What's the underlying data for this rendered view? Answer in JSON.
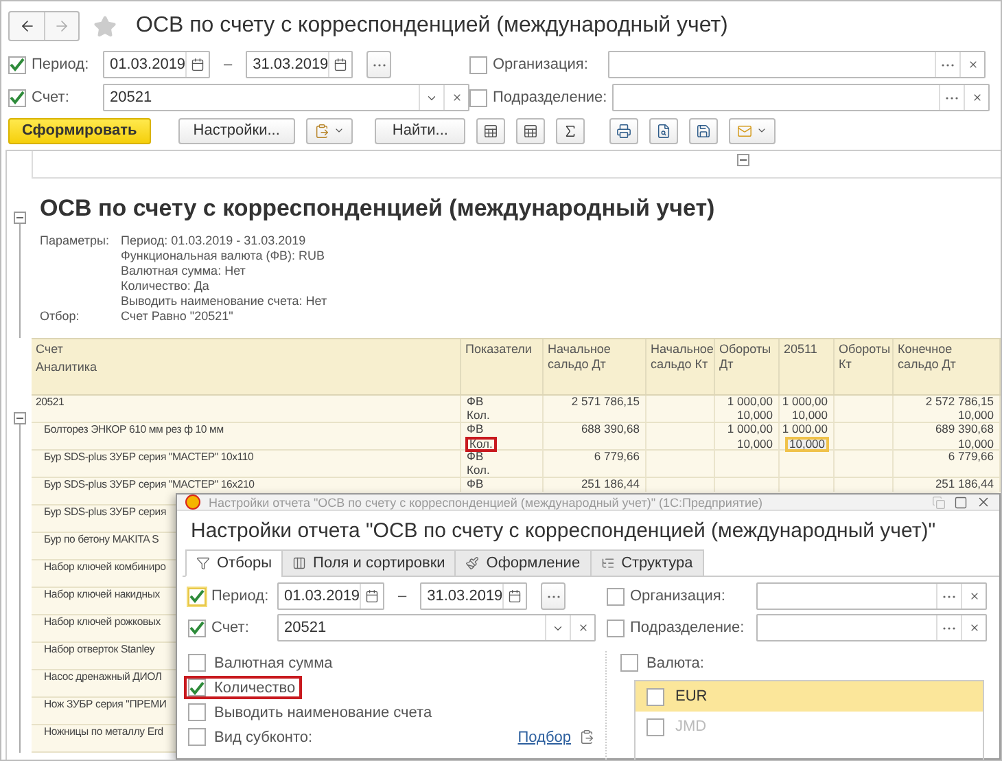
{
  "window": {
    "title": "ОСВ по счету с корреспонденцией (международный учет)"
  },
  "filters": {
    "period": {
      "checked": true,
      "label": "Период:",
      "from": "01.03.2019",
      "dash": "–",
      "to": "31.03.2019"
    },
    "account": {
      "checked": true,
      "label": "Счет:",
      "value": "20521"
    },
    "organization": {
      "checked": false,
      "label": "Организация:"
    },
    "division": {
      "checked": false,
      "label": "Подразделение:"
    }
  },
  "toolbar": {
    "generate": "Сформировать",
    "settings": "Настройки...",
    "find": "Найти..."
  },
  "report": {
    "title": "ОСВ по счету с корреспонденцией (международный учет)",
    "parameters": [
      {
        "label": "Параметры:",
        "values": [
          "Период: 01.03.2019 - 31.03.2019",
          "Функциональная валюта (ФВ): RUB",
          "Валютная сумма: Нет",
          "Количество: Да",
          "Выводить наименование счета: Нет"
        ]
      },
      {
        "label": "Отбор:",
        "values": [
          "Счет Равно \"20521\""
        ]
      }
    ],
    "table": {
      "account_header": [
        "Счет",
        "Аналитика"
      ],
      "columns": {
        "indicator": "Показатели",
        "opening_dt": "Начальное сальдо Дт",
        "opening_kt": "Начальное сальдо Кт",
        "turnover_dt": "Обороты Дт",
        "turnover_dt_sub": "20511",
        "turnover_kt": "Обороты Кт",
        "closing_dt": "Конечное сальдо Дт"
      },
      "rows": [
        {
          "name": "20521",
          "expanded": true,
          "lines": [
            {
              "indicator": "ФВ",
              "marked": false,
              "opening_dt": {
                "text": "2 571 786,15",
                "selected": false
              },
              "turnover_dt": {
                "text": "1 000,00",
                "selected": false
              },
              "turnover_dt_sub": {
                "text": "1 000,00",
                "selected": false
              },
              "closing_dt": {
                "text": "2 572 786,15",
                "selected": false
              }
            },
            {
              "indicator": "Кол.",
              "marked": false,
              "turnover_dt": {
                "text": "10,000",
                "selected": false
              },
              "turnover_dt_sub": {
                "text": "10,000",
                "selected": false
              },
              "closing_dt": {
                "text": "10,000",
                "selected": false
              }
            }
          ],
          "children": [
            {
              "name": "Болторез ЭНКОР 610 мм рез ф 10 мм",
              "lines": [
                {
                  "indicator": "ФВ",
                  "marked": false,
                  "opening_dt": {
                    "text": "688 390,68",
                    "selected": false
                  },
                  "turnover_dt": {
                    "text": "1 000,00",
                    "selected": false
                  },
                  "turnover_dt_sub": {
                    "text": "1 000,00",
                    "selected": false
                  },
                  "closing_dt": {
                    "text": "689 390,68",
                    "selected": false
                  }
                },
                {
                  "indicator": "Кол.",
                  "marked": true,
                  "turnover_dt": {
                    "text": "10,000",
                    "selected": false
                  },
                  "turnover_dt_sub": {
                    "text": "10,000",
                    "selected": true
                  },
                  "closing_dt": {
                    "text": "10,000",
                    "selected": false
                  }
                }
              ]
            },
            {
              "name": "Бур SDS-plus ЗУБР серия \"МАСТЕР\" 10x110",
              "lines": [
                {
                  "indicator": "ФВ",
                  "marked": false,
                  "opening_dt": {
                    "text": "6 779,66",
                    "selected": false
                  },
                  "closing_dt": {
                    "text": "6 779,66",
                    "selected": false
                  }
                },
                {
                  "indicator": "Кол.",
                  "marked": false
                }
              ]
            },
            {
              "name": "Бур SDS-plus ЗУБР серия \"МАСТЕР\" 16x210",
              "lines": [
                {
                  "indicator": "ФВ",
                  "marked": false,
                  "opening_dt": {
                    "text": "251 186,44",
                    "selected": false
                  },
                  "closing_dt": {
                    "text": "251 186,44",
                    "selected": false
                  }
                }
              ]
            },
            {
              "name": "Бур SDS-plus ЗУБР серия"
            },
            {
              "name": "Бур по бетону MAKITA S"
            },
            {
              "name": "Набор ключей комбиниро"
            },
            {
              "name": "Набор ключей накидных"
            },
            {
              "name": "Набор ключей рожковых"
            },
            {
              "name": "Набор отверток Stanley"
            },
            {
              "name": "Насос дренажный ДИОЛ"
            },
            {
              "name": "Нож ЗУБР серия \"ПРЕМИ"
            },
            {
              "name": "Ножницы по металлу Erd"
            }
          ]
        }
      ]
    }
  },
  "dialog": {
    "window_title": "Настройки отчета \"ОСВ по счету с корреспонденцией (международный учет)\"  (1С:Предприятие)",
    "heading": "Настройки отчета \"ОСВ по счету с корреспонденцией (международный учет)\"",
    "tabs": [
      {
        "label": "Отборы",
        "selected": true
      },
      {
        "label": "Поля и сортировки",
        "selected": false
      },
      {
        "label": "Оформление",
        "selected": false
      },
      {
        "label": "Структура",
        "selected": false
      }
    ],
    "filters": {
      "period": {
        "checked": true,
        "focused": true,
        "label": "Период:",
        "from": "01.03.2019",
        "dash": "–",
        "to": "31.03.2019"
      },
      "account": {
        "checked": true,
        "label": "Счет:",
        "value": "20521"
      },
      "organization": {
        "checked": false,
        "label": "Организация:"
      },
      "division": {
        "checked": false,
        "label": "Подразделение:"
      }
    },
    "options": [
      {
        "label": "Валютная сумма",
        "checked": false,
        "marked": false
      },
      {
        "label": "Количество",
        "checked": true,
        "marked": true
      },
      {
        "label": "Выводить наименование счета",
        "checked": false,
        "marked": false
      }
    ],
    "subconto": {
      "label": "Вид субконто:",
      "checked": false,
      "link": "Подбор"
    },
    "currency": {
      "label": "Валюта:",
      "checked": false,
      "items": [
        {
          "label": "EUR",
          "checked": false,
          "selected": true,
          "disabled": false
        },
        {
          "label": "JMD",
          "checked": false,
          "selected": false,
          "disabled": true
        }
      ]
    }
  }
}
